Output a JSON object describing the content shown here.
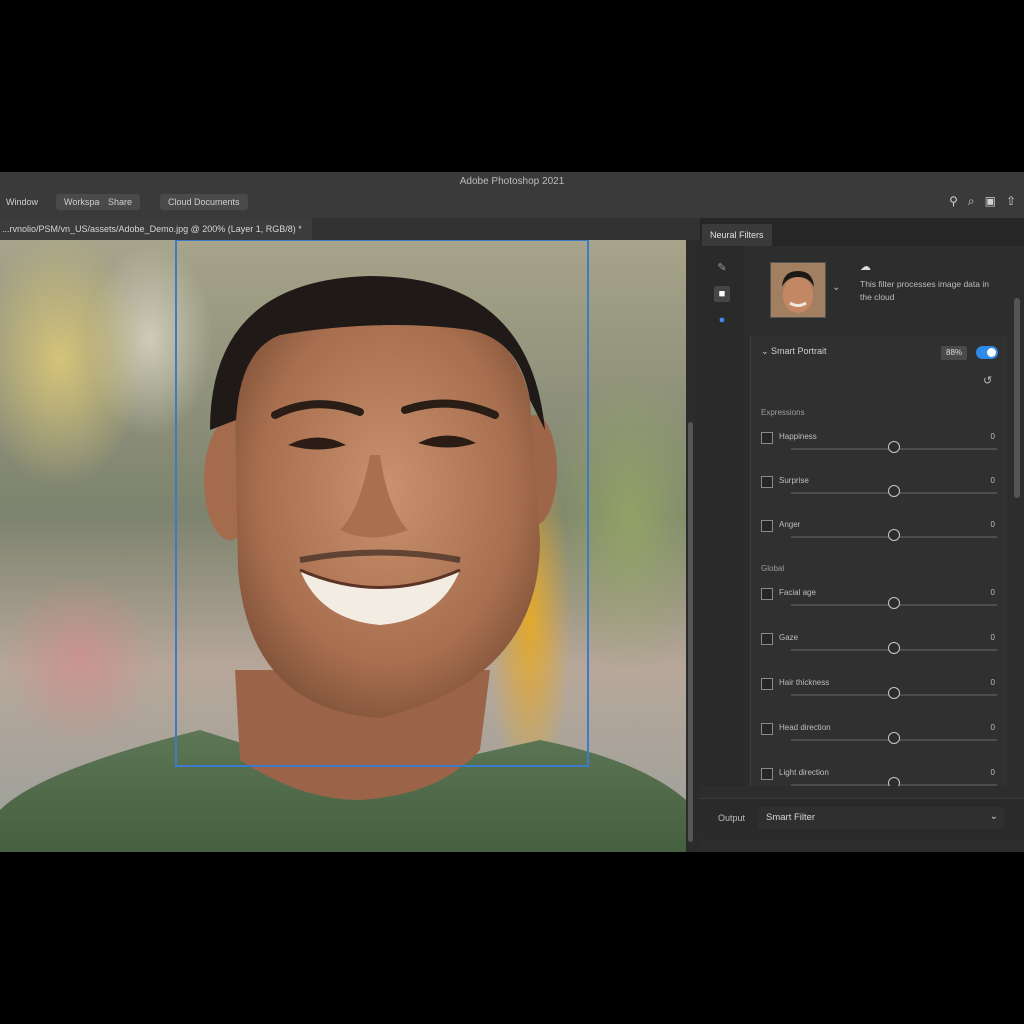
{
  "app": {
    "title": "Adobe Photoshop 2021",
    "menu": [
      "Window",
      "Workspace",
      "Share",
      "Cloud Documents"
    ],
    "icons": [
      "search-icon",
      "zoom-icon",
      "workspace-icon",
      "share-icon"
    ]
  },
  "document": {
    "tab_label": "...rvnolio/PSM/vn_US/assets/Adobe_Demo.jpg @ 200% (Layer 1, RGB/8) *"
  },
  "panel": {
    "tab_label": "Neural Filters",
    "tools": [
      "brush-icon",
      "lock-icon",
      "marker-icon"
    ],
    "thumb_text": "This filter processes image data in the cloud",
    "filter": {
      "title": "Smart Portrait",
      "badge": "88%",
      "enabled": true,
      "sections": [
        {
          "title": "Expressions",
          "rows": [
            {
              "label": "Happiness",
              "value": "0",
              "checked": false,
              "level": 0.5
            },
            {
              "label": "Surprise",
              "value": "0",
              "checked": false,
              "level": 0.5
            },
            {
              "label": "Anger",
              "value": "0",
              "checked": false,
              "level": 0.5
            }
          ]
        },
        {
          "title": "Global",
          "rows": [
            {
              "label": "Facial age",
              "value": "0",
              "checked": false,
              "level": 0.5
            },
            {
              "label": "Gaze",
              "value": "0",
              "checked": false,
              "level": 0.5
            },
            {
              "label": "Hair thickness",
              "value": "0",
              "checked": false,
              "level": 0.5
            },
            {
              "label": "Head direction",
              "value": "0",
              "checked": false,
              "level": 0.5
            },
            {
              "label": "Light direction",
              "value": "0",
              "checked": false,
              "level": 0.5
            }
          ]
        }
      ]
    },
    "output": {
      "label": "Output",
      "value": "Smart Filter"
    }
  }
}
